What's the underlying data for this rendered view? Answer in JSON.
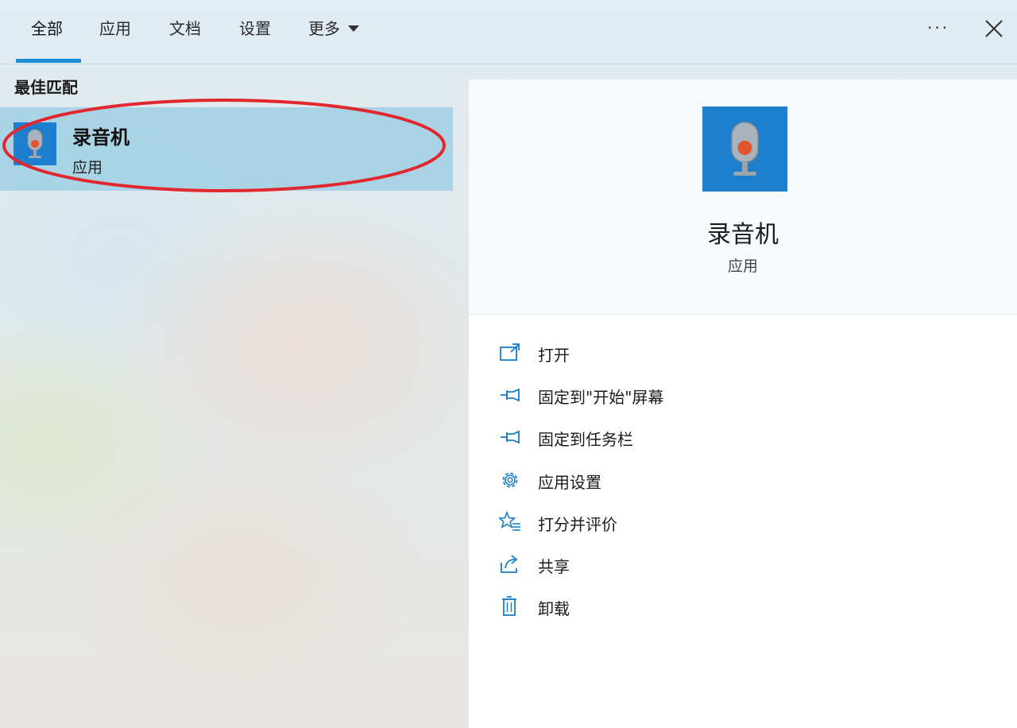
{
  "tabs": [
    {
      "label": "全部",
      "active": true
    },
    {
      "label": "应用",
      "active": false
    },
    {
      "label": "文档",
      "active": false
    },
    {
      "label": "设置",
      "active": false
    },
    {
      "label": "更多",
      "active": false
    }
  ],
  "window_controls": {
    "more_label": "···"
  },
  "best_match": {
    "section_label": "最佳匹配",
    "item": {
      "title": "录音机",
      "subtitle": "应用",
      "icon": "microphone-icon"
    }
  },
  "detail": {
    "title": "录音机",
    "subtitle": "应用",
    "icon": "microphone-icon",
    "actions": [
      {
        "label": "打开",
        "icon": "open-icon"
      },
      {
        "label": "固定到\"开始\"屏幕",
        "icon": "pin-icon"
      },
      {
        "label": "固定到任务栏",
        "icon": "pin-icon"
      },
      {
        "label": "应用设置",
        "icon": "gear-icon"
      },
      {
        "label": "打分并评价",
        "icon": "rate-star-icon"
      },
      {
        "label": "共享",
        "icon": "share-icon"
      },
      {
        "label": "卸载",
        "icon": "trash-icon"
      }
    ]
  },
  "colors": {
    "accent": "#1a8fd4",
    "selection": "#a0d0e4",
    "app_tile": "#1f7fcf",
    "annotation": "#e0282e"
  }
}
